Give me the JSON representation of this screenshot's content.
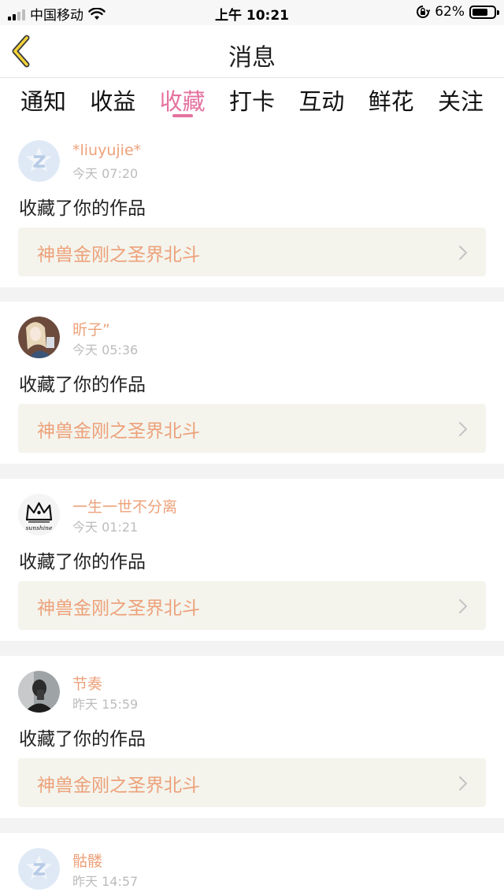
{
  "status_bar": {
    "carrier": "中国移动",
    "time": "上午 10:21",
    "battery": "62%",
    "battery_level": 0.62,
    "icons": [
      "signal-icon",
      "wifi-icon",
      "orientation-lock-icon",
      "battery-icon"
    ]
  },
  "nav": {
    "title": "消息",
    "back_icon": "back-arrow-icon"
  },
  "tabs": [
    {
      "label": "通知",
      "active": false
    },
    {
      "label": "收益",
      "active": false
    },
    {
      "label": "收藏",
      "active": true
    },
    {
      "label": "打卡",
      "active": false
    },
    {
      "label": "互动",
      "active": false
    },
    {
      "label": "鲜花",
      "active": false
    },
    {
      "label": "关注",
      "active": false
    }
  ],
  "colors": {
    "accent": "#e4739f",
    "name": "#eda17a",
    "time": "#bcbcbc",
    "work_bg": "#f4f4ed"
  },
  "messages": [
    {
      "name": "*liuyujie*",
      "time": "今天 07:20",
      "action": "收藏了你的作品",
      "work": "神兽金刚之圣界北斗",
      "avatar": "default-avatar"
    },
    {
      "name": "昕子”",
      "time": "今天 05:36",
      "action": "收藏了你的作品",
      "work": "神兽金刚之圣界北斗",
      "avatar": "photo-avatar"
    },
    {
      "name": "一生一世不分离",
      "time": "今天 01:21",
      "action": "收藏了你的作品",
      "work": "神兽金刚之圣界北斗",
      "avatar": "crown-avatar",
      "avatar_text": "sunshine"
    },
    {
      "name": "节奏",
      "time": "昨天 15:59",
      "action": "收藏了你的作品",
      "work": "神兽金刚之圣界北斗",
      "avatar": "photo-avatar"
    },
    {
      "name": "骷髅",
      "time": "昨天 14:57",
      "avatar": "default-avatar"
    }
  ]
}
